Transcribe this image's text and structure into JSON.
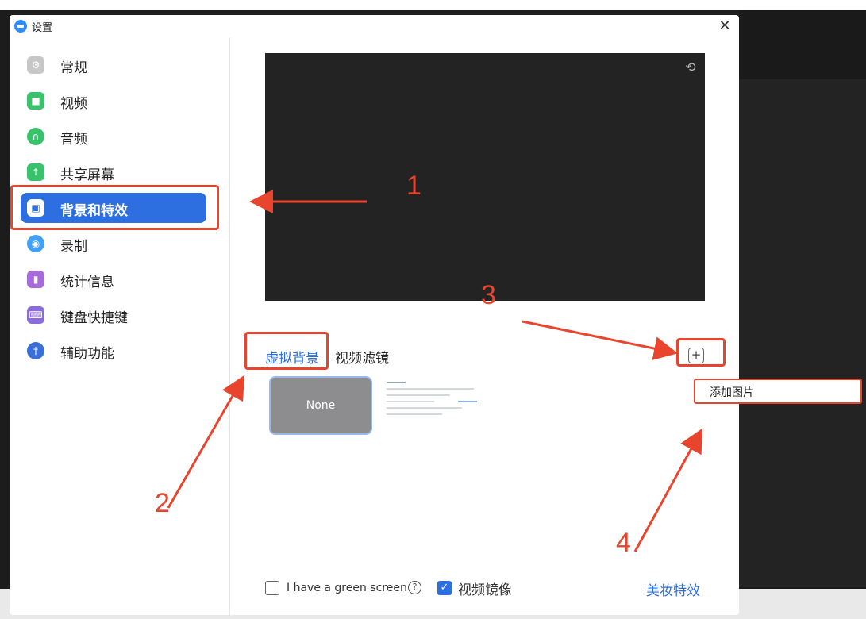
{
  "window": {
    "title": "设置"
  },
  "sidebar": {
    "items": [
      {
        "label": "常规",
        "color": "#c7c7c7",
        "icon": "gear-icon"
      },
      {
        "label": "视频",
        "color": "#37c26b",
        "icon": "camera-icon"
      },
      {
        "label": "音频",
        "color": "#37c26b",
        "icon": "headphones-icon"
      },
      {
        "label": "共享屏幕",
        "color": "#37c26b",
        "icon": "share-screen-icon"
      },
      {
        "label": "背景和特效",
        "color": "#ffffff",
        "icon": "portrait-icon",
        "active": true
      },
      {
        "label": "录制",
        "color": "#3fa0f5",
        "icon": "record-icon"
      },
      {
        "label": "统计信息",
        "color": "#a66ad9",
        "icon": "stats-icon"
      },
      {
        "label": "键盘快捷键",
        "color": "#8a6bd9",
        "icon": "keyboard-icon"
      },
      {
        "label": "辅助功能",
        "color": "#3a6fd8",
        "icon": "accessibility-icon"
      }
    ]
  },
  "tabs": {
    "virtual_bg": "虚拟背景",
    "video_filter": "视频滤镜"
  },
  "backgrounds": {
    "none_label": "None"
  },
  "popup": {
    "add_image": "添加图片"
  },
  "footer": {
    "green_screen": "I have a green screen",
    "mirror": "视频镜像",
    "mirror_checked": true,
    "green_checked": false,
    "beauty": "美妆特效"
  },
  "annotations": [
    "1",
    "2",
    "3",
    "4"
  ],
  "colors": {
    "accent": "#2d6ee0",
    "annotation": "#e8442e",
    "preview_bg": "#232323"
  }
}
